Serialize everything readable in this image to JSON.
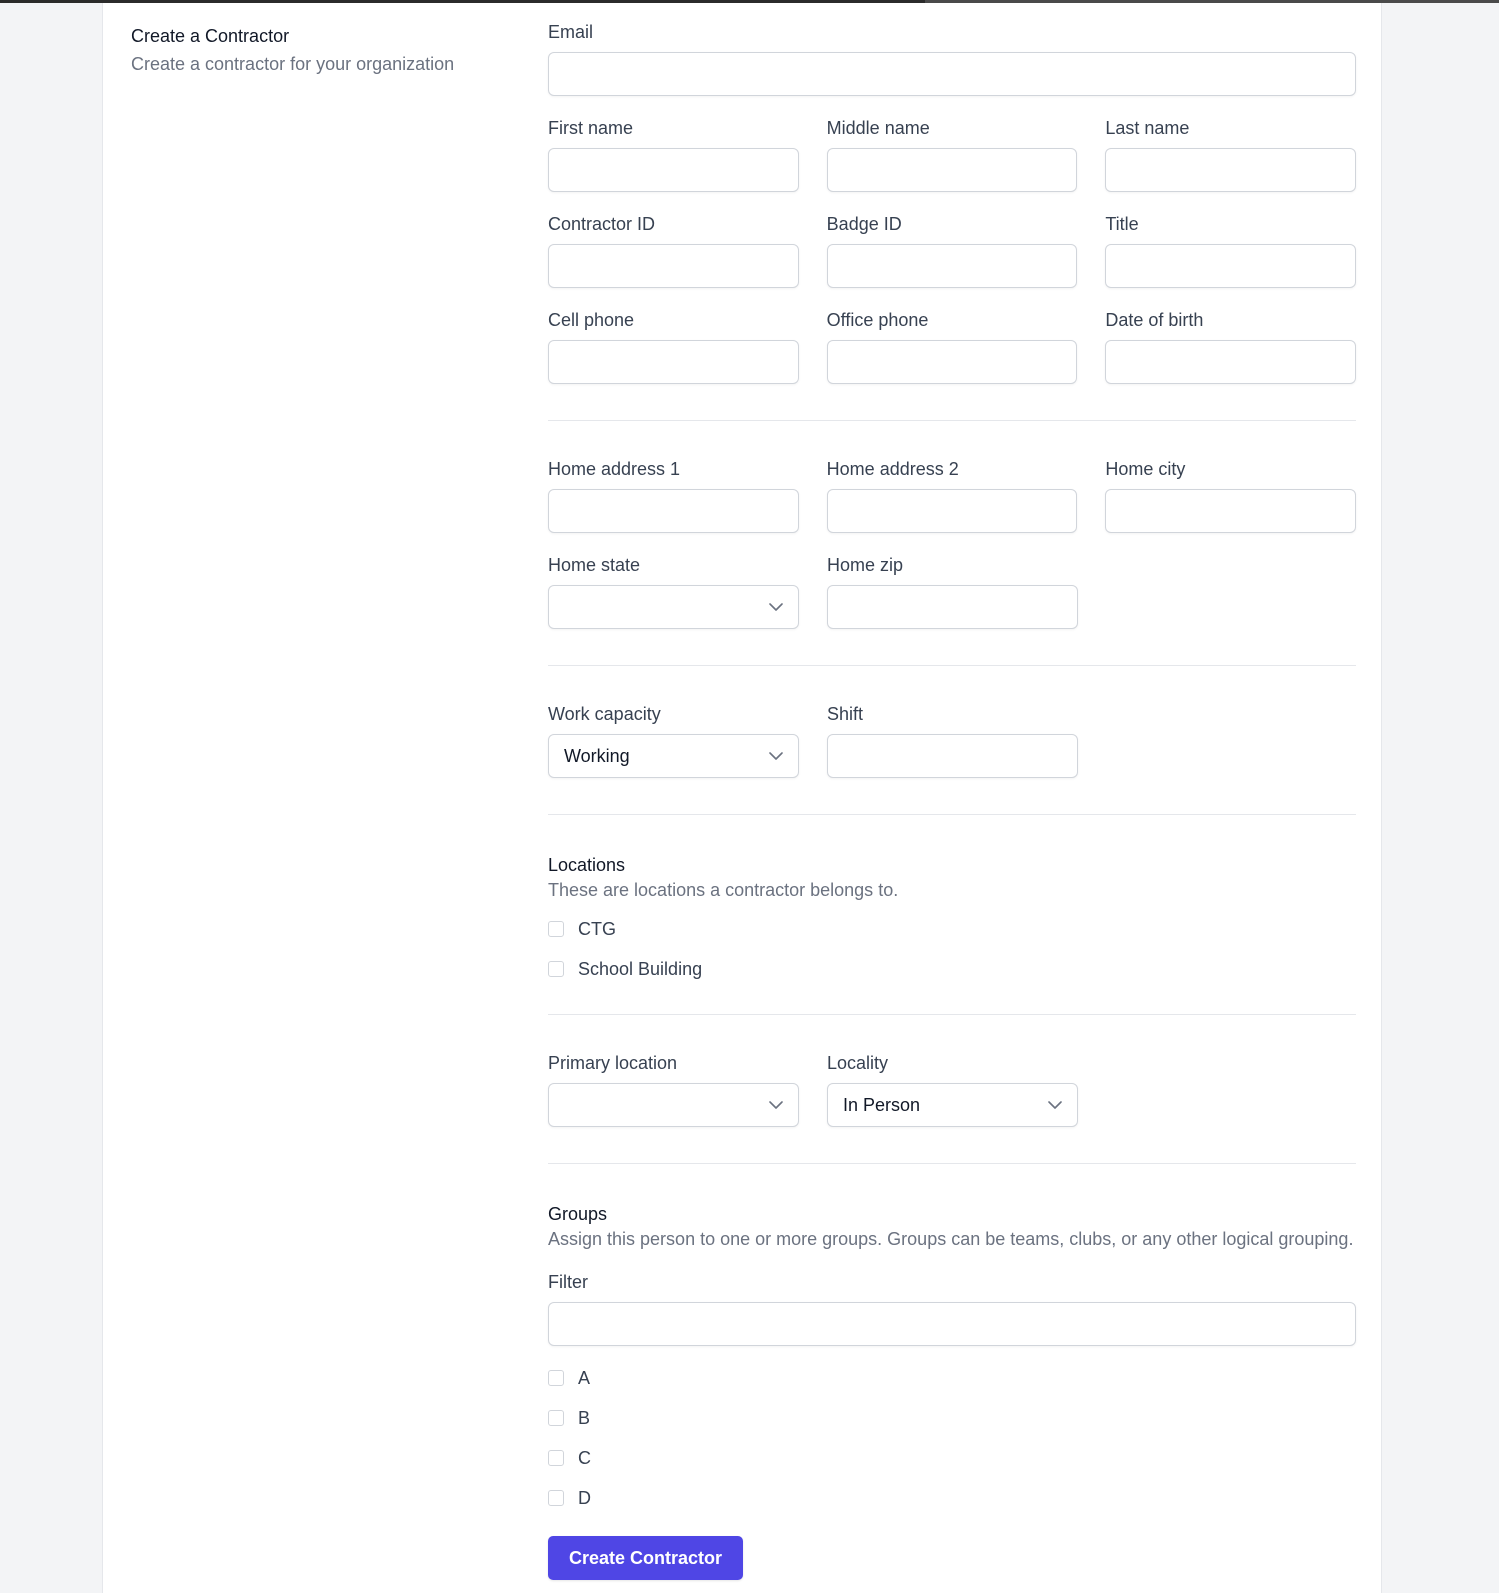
{
  "header": {
    "title": "Create a Contractor",
    "subtitle": "Create a contractor for your organization"
  },
  "fields": {
    "email": {
      "label": "Email",
      "value": ""
    },
    "first_name": {
      "label": "First name",
      "value": ""
    },
    "middle_name": {
      "label": "Middle name",
      "value": ""
    },
    "last_name": {
      "label": "Last name",
      "value": ""
    },
    "contractor_id": {
      "label": "Contractor ID",
      "value": ""
    },
    "badge_id": {
      "label": "Badge ID",
      "value": ""
    },
    "title": {
      "label": "Title",
      "value": ""
    },
    "cell_phone": {
      "label": "Cell phone",
      "value": ""
    },
    "office_phone": {
      "label": "Office phone",
      "value": ""
    },
    "date_of_birth": {
      "label": "Date of birth",
      "value": ""
    },
    "home_address_1": {
      "label": "Home address 1",
      "value": ""
    },
    "home_address_2": {
      "label": "Home address 2",
      "value": ""
    },
    "home_city": {
      "label": "Home city",
      "value": ""
    },
    "home_state": {
      "label": "Home state",
      "value": ""
    },
    "home_zip": {
      "label": "Home zip",
      "value": ""
    },
    "work_capacity": {
      "label": "Work capacity",
      "value": "Working"
    },
    "shift": {
      "label": "Shift",
      "value": ""
    },
    "primary_location": {
      "label": "Primary location",
      "value": ""
    },
    "locality": {
      "label": "Locality",
      "value": "In Person"
    },
    "filter": {
      "label": "Filter",
      "value": ""
    }
  },
  "locations": {
    "title": "Locations",
    "description": "These are locations a contractor belongs to.",
    "items": [
      {
        "label": "CTG",
        "checked": false
      },
      {
        "label": "School Building",
        "checked": false
      }
    ]
  },
  "groups": {
    "title": "Groups",
    "description": "Assign this person to one or more groups. Groups can be teams, clubs, or any other logical grouping.",
    "items": [
      {
        "label": "A",
        "checked": false
      },
      {
        "label": "B",
        "checked": false
      },
      {
        "label": "C",
        "checked": false
      },
      {
        "label": "D",
        "checked": false
      }
    ]
  },
  "actions": {
    "submit_label": "Create Contractor"
  },
  "icons": {
    "dropdown": "chevron-down-icon"
  },
  "colors": {
    "primary": "#4f46e5",
    "border": "#d1d5db",
    "background": "#f3f4f6"
  }
}
